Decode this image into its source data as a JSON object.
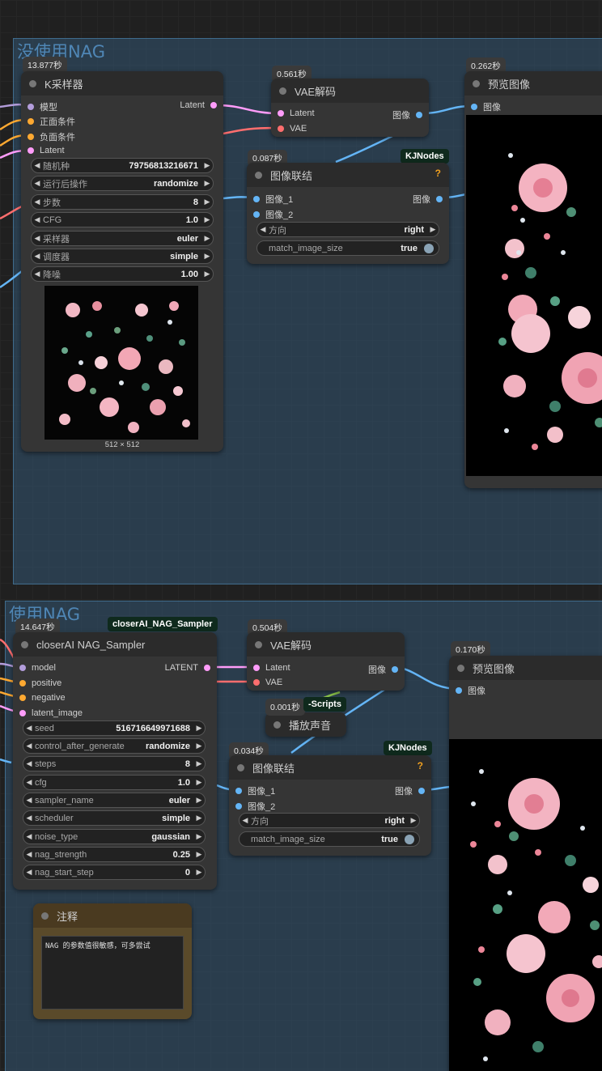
{
  "groups": {
    "top_title": "没使用NAG",
    "bottom_title": "使用NAG"
  },
  "ksampler": {
    "time": "13.877秒",
    "title": "K采样器",
    "inputs": [
      "模型",
      "正面条件",
      "负面条件",
      "Latent"
    ],
    "output": "Latent",
    "widgets": [
      {
        "label": "随机种",
        "value": "79756813216671"
      },
      {
        "label": "运行后操作",
        "value": "randomize"
      },
      {
        "label": "步数",
        "value": "8"
      },
      {
        "label": "CFG",
        "value": "1.0"
      },
      {
        "label": "采样器",
        "value": "euler"
      },
      {
        "label": "调度器",
        "value": "simple"
      },
      {
        "label": "降噪",
        "value": "1.00"
      }
    ],
    "preview_size": "512 × 512"
  },
  "vae_top": {
    "time": "0.561秒",
    "title": "VAE解码",
    "inputs": [
      "Latent",
      "VAE"
    ],
    "output": "图像"
  },
  "preview_top": {
    "time": "0.262秒",
    "title": "预览图像",
    "input": "图像"
  },
  "concat_top": {
    "time": "0.087秒",
    "pack": "KJNodes",
    "help": "?",
    "title": "图像联结",
    "inputs": [
      "图像_1",
      "图像_2"
    ],
    "output": "图像",
    "direction_label": "方向",
    "direction_value": "right",
    "match_label": "match_image_size",
    "match_value": "true"
  },
  "nag": {
    "time": "14.647秒",
    "pack": "closerAI_NAG_Sampler",
    "title": "closerAI NAG_Sampler",
    "inputs": [
      "model",
      "positive",
      "negative",
      "latent_image"
    ],
    "output": "LATENT",
    "widgets": [
      {
        "label": "seed",
        "value": "516716649971688"
      },
      {
        "label": "control_after_generate",
        "value": "randomize"
      },
      {
        "label": "steps",
        "value": "8"
      },
      {
        "label": "cfg",
        "value": "1.0"
      },
      {
        "label": "sampler_name",
        "value": "euler"
      },
      {
        "label": "scheduler",
        "value": "simple"
      },
      {
        "label": "noise_type",
        "value": "gaussian"
      },
      {
        "label": "nag_strength",
        "value": "0.25"
      },
      {
        "label": "nag_start_step",
        "value": "0"
      }
    ]
  },
  "vae_bottom": {
    "time": "0.504秒",
    "title": "VAE解码",
    "inputs": [
      "Latent",
      "VAE"
    ],
    "output": "图像"
  },
  "sound": {
    "time": "0.001秒",
    "pack": "-Scripts",
    "title": "播放声音"
  },
  "concat_bottom": {
    "time": "0.034秒",
    "pack": "KJNodes",
    "help": "?",
    "title": "图像联结",
    "inputs": [
      "图像_1",
      "图像_2"
    ],
    "output": "图像",
    "direction_label": "方向",
    "direction_value": "right",
    "match_label": "match_image_size",
    "match_value": "true"
  },
  "preview_bottom": {
    "time": "0.170秒",
    "title": "预览图像",
    "input": "图像"
  },
  "note": {
    "title": "注释",
    "text": "NAG 的参数值很敏感，可多尝试"
  },
  "colors": {
    "model": "#b39ddb",
    "conditioning": "#ffa931",
    "latent": "#ff9cf9",
    "vae": "#ff6e6e",
    "image": "#64b5f6",
    "group_bg": "#335573",
    "note_bg": "#5a4a2a"
  }
}
